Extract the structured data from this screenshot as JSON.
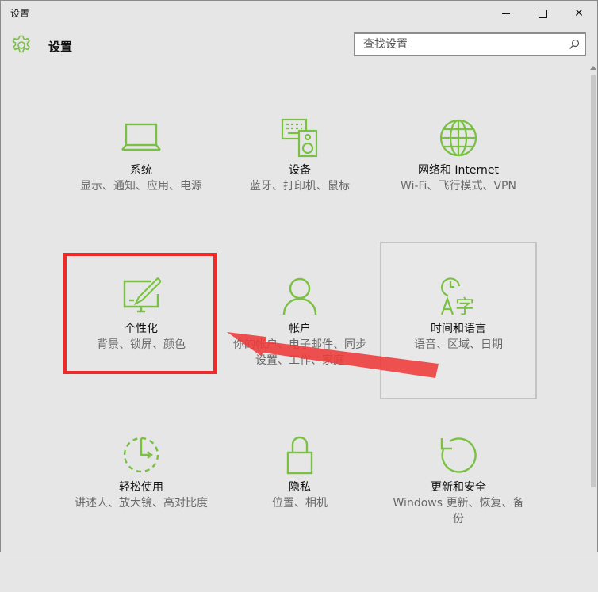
{
  "window": {
    "title": "设置",
    "controls": {
      "minimize": "minimize",
      "maximize": "maximize",
      "close": "✕"
    }
  },
  "header": {
    "title": "设置",
    "search_placeholder": "查找设置"
  },
  "colors": {
    "accent": "#7ac143",
    "background": "#e6e6e6",
    "annotation": "#ee2a2a"
  },
  "tiles": [
    {
      "name": "系统",
      "desc": "显示、通知、应用、电源",
      "icon": "laptop-icon"
    },
    {
      "name": "设备",
      "desc": "蓝牙、打印机、鼠标",
      "icon": "devices-icon"
    },
    {
      "name": "网络和 Internet",
      "desc": "Wi-Fi、飞行模式、VPN",
      "icon": "globe-icon"
    },
    {
      "name": "个性化",
      "desc": "背景、锁屏、颜色",
      "icon": "personalization-icon"
    },
    {
      "name": "帐户",
      "desc": "你的帐户、电子邮件、同步设置、工作、家庭",
      "icon": "person-icon"
    },
    {
      "name": "时间和语言",
      "desc": "语音、区域、日期",
      "icon": "time-language-icon"
    },
    {
      "name": "轻松使用",
      "desc": "讲述人、放大镜、高对比度",
      "icon": "ease-of-access-icon"
    },
    {
      "name": "隐私",
      "desc": "位置、相机",
      "icon": "lock-icon"
    },
    {
      "name": "更新和安全",
      "desc": "Windows 更新、恢复、备份",
      "icon": "refresh-icon"
    }
  ]
}
